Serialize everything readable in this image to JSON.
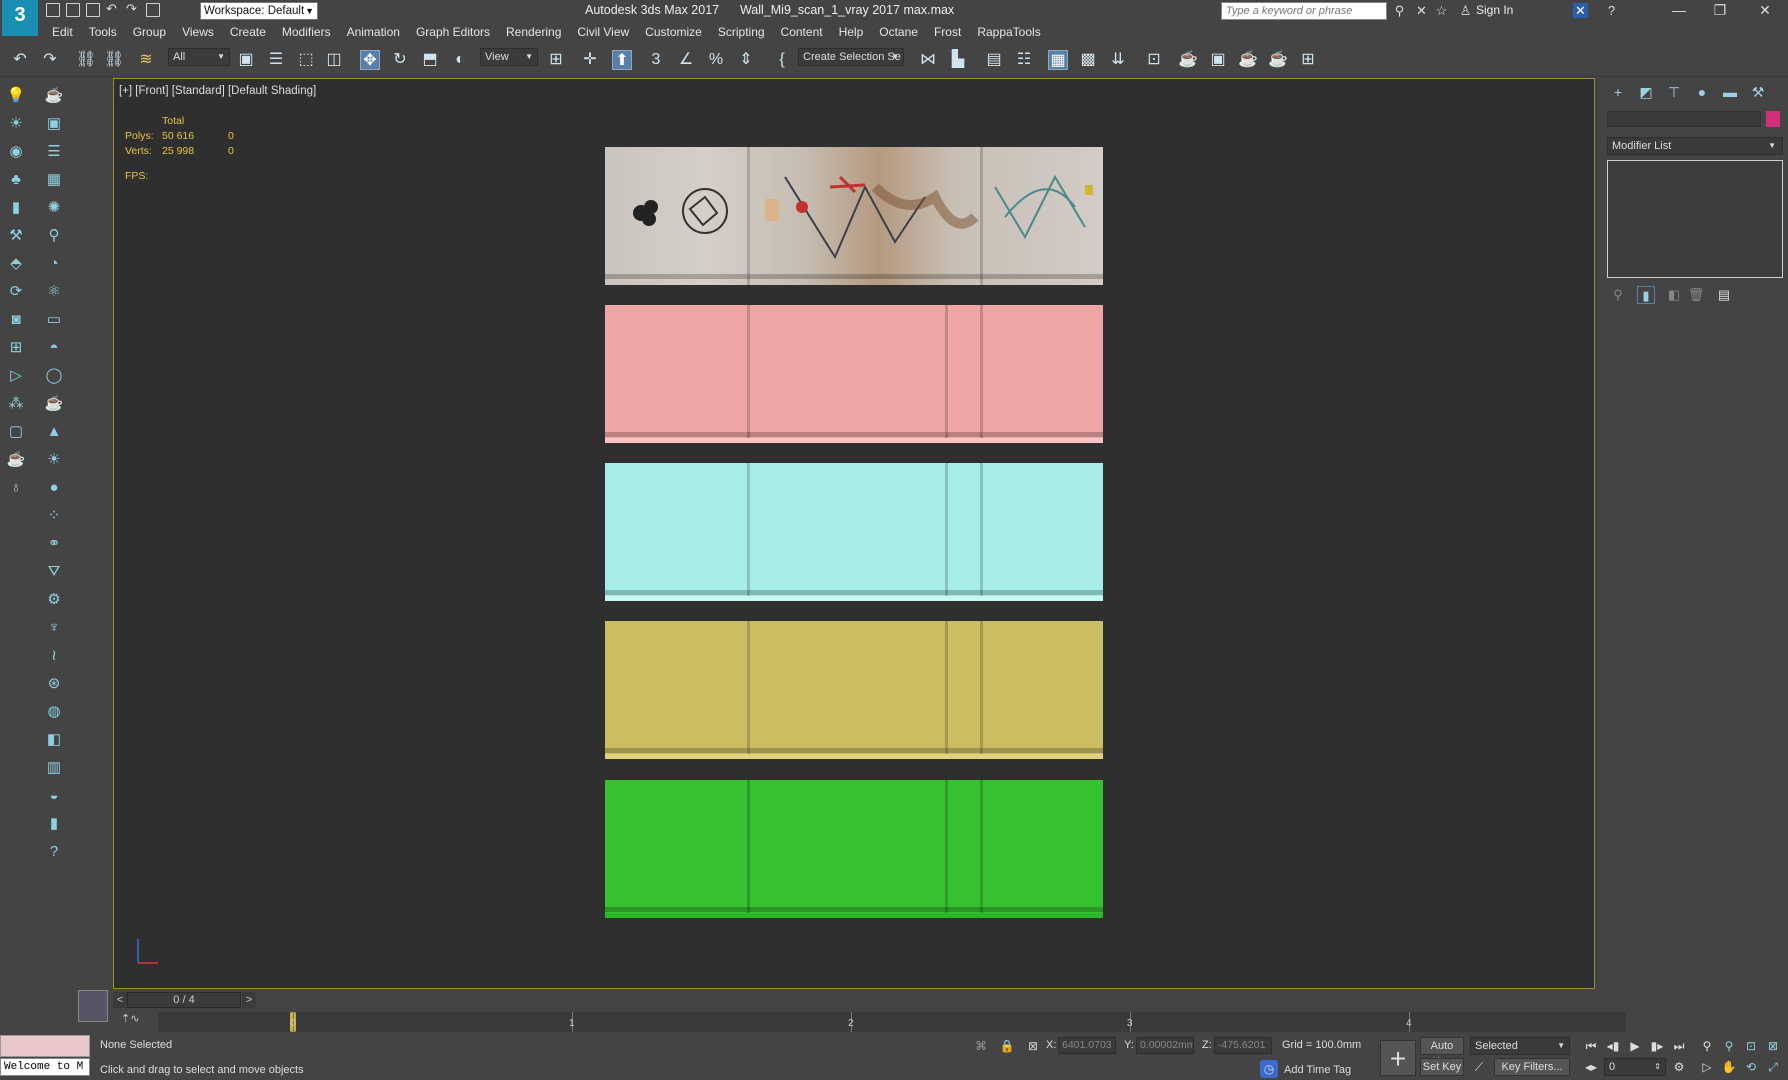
{
  "titlebar": {
    "logo": "3",
    "workspace": "Workspace: Default",
    "app_name": "Autodesk 3ds Max 2017",
    "file_name": "Wall_Mi9_scan_1_vray 2017 max.max",
    "search_placeholder": "Type a keyword or phrase",
    "sign_in": "Sign In",
    "icons": [
      "new-icon",
      "open-icon",
      "save-icon",
      "undo-icon",
      "redo-icon",
      "project-icon"
    ]
  },
  "menubar": [
    "Edit",
    "Tools",
    "Group",
    "Views",
    "Create",
    "Modifiers",
    "Animation",
    "Graph Editors",
    "Rendering",
    "Civil View",
    "Customize",
    "Scripting",
    "Content",
    "Help",
    "Octane",
    "Frost",
    "RappaTools"
  ],
  "toolbar": {
    "selection_filter": "All",
    "ref_coord": "View",
    "named_selection": "Create Selection Se"
  },
  "viewport": {
    "label": "[+] [Front] [Standard] [Default Shading]",
    "stats": {
      "header": "Total",
      "polys_label": "Polys:",
      "polys_total": "50 616",
      "polys_sel": "0",
      "verts_label": "Verts:",
      "verts_total": "25 998",
      "verts_sel": "0",
      "fps_label": "FPS:"
    },
    "panels": [
      {
        "name": "photo-texture-panel",
        "color": "#cfc9c1"
      },
      {
        "name": "pink-mesh-panel",
        "color": "#f0a5a5"
      },
      {
        "name": "cyan-mesh-panel",
        "color": "#a5ede6"
      },
      {
        "name": "olive-mesh-panel",
        "color": "#cbbd62"
      },
      {
        "name": "green-mesh-panel",
        "color": "#36c131"
      }
    ]
  },
  "command_panel": {
    "modifier_list": "Modifier List",
    "object_color": "#d0307a"
  },
  "timeline": {
    "frame_display": "0 / 4",
    "ticks": [
      "0",
      "1",
      "2",
      "3",
      "4"
    ]
  },
  "statusbar": {
    "maxscript_text": "Welcome to M",
    "selection_status": "None Selected",
    "prompt": "Click and drag to select and move objects",
    "x_label": "X:",
    "x_value": "6401.0703",
    "y_label": "Y:",
    "y_value": "0.00002mm",
    "z_label": "Z:",
    "z_value": "-475.6201",
    "grid": "Grid = 100.0mm",
    "add_time_tag": "Add Time Tag",
    "auto_key": "Auto Key",
    "set_key": "Set Key",
    "key_mode": "Selected",
    "key_filters": "Key Filters...",
    "current_frame": "0"
  }
}
